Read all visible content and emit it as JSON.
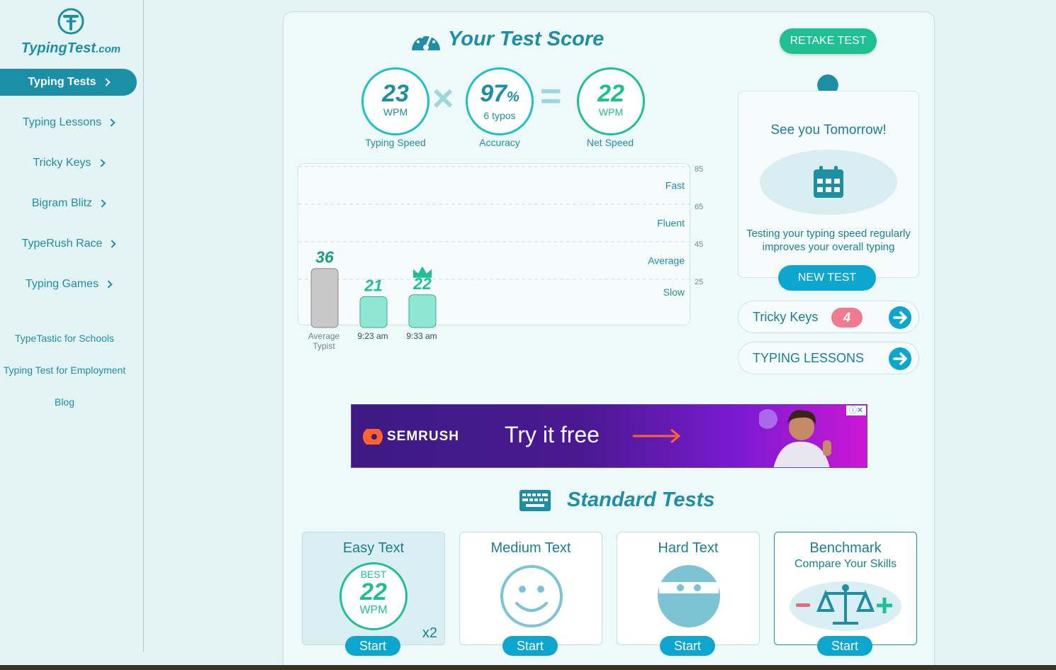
{
  "sidebar": {
    "logo": {
      "name": "TypingTest",
      "suffix": ".com"
    },
    "nav": [
      {
        "label": "Typing Tests"
      },
      {
        "label": "Typing Lessons"
      },
      {
        "label": "Tricky Keys"
      },
      {
        "label": "Bigram Blitz"
      },
      {
        "label": "TypeRush Race"
      },
      {
        "label": "Typing Games"
      }
    ],
    "links": [
      "TypeTastic for Schools",
      "Typing Test for Employment",
      "Blog"
    ]
  },
  "score": {
    "title": "Your Test Score",
    "retake_label": "RETAKE TEST",
    "typing_speed": {
      "value": "23",
      "unit": "WPM",
      "caption": "Typing Speed"
    },
    "accuracy": {
      "value": "97",
      "percent": "%",
      "sub": "6 typos",
      "caption": "Accuracy"
    },
    "net_speed": {
      "value": "22",
      "unit": "WPM",
      "caption": "Net Speed"
    }
  },
  "chart_data": {
    "type": "bar",
    "categories": [
      "Average\nTypist",
      "9:23 am",
      "9:33 am"
    ],
    "values": [
      36,
      21,
      22
    ],
    "ylim": [
      0,
      85
    ],
    "ticks": [
      25,
      45,
      65,
      85
    ],
    "zones": [
      "Slow",
      "Average",
      "Fluent",
      "Fast"
    ],
    "highlight_index": 2,
    "colors": {
      "average": "#c8c8c8",
      "user": "#8fe6d2",
      "label": "#1fbf94",
      "average_label": "#1a9a8c"
    }
  },
  "tomorrow": {
    "title": "See you Tomorrow!",
    "text": "Testing your typing speed regularly improves your overall typing",
    "new_test_label": "NEW TEST"
  },
  "tricky": {
    "label": "Tricky Keys",
    "count": "4"
  },
  "lessons": {
    "label": "TYPING LESSONS"
  },
  "ad": {
    "brand": "SEMRUSH",
    "cta": "Try it free"
  },
  "standard": {
    "title": "Standard Tests",
    "cards": [
      {
        "name": "Easy Text",
        "best_label": "BEST",
        "best_value": "22",
        "best_unit": "WPM",
        "multiplier": "x2",
        "start": "Start"
      },
      {
        "name": "Medium Text",
        "start": "Start"
      },
      {
        "name": "Hard Text",
        "start": "Start"
      },
      {
        "name": "Benchmark",
        "sub": "Compare Your Skills",
        "start": "Start"
      }
    ]
  }
}
